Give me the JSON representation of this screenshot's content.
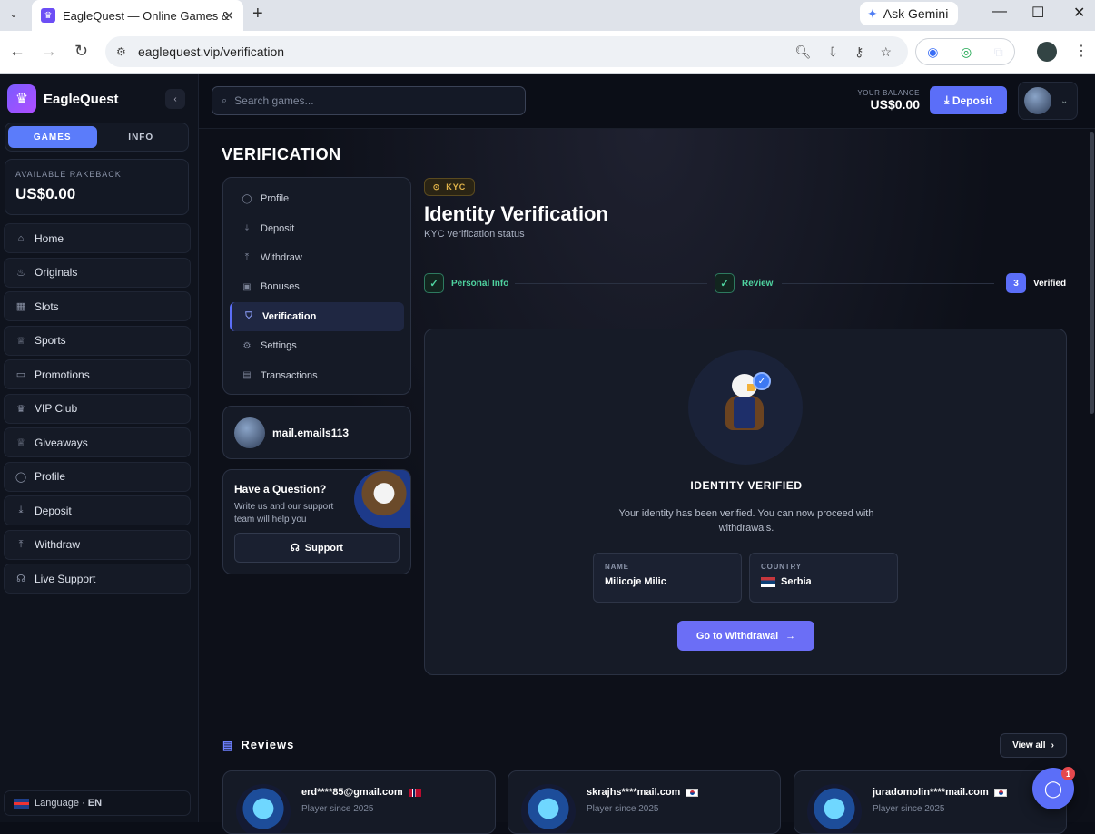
{
  "browser": {
    "tab_title": "EagleQuest — Online Games &",
    "gemini_label": "Ask Gemini",
    "url": "eaglequest.vip/verification",
    "icons": [
      "zoom-icon",
      "install-icon",
      "key-icon",
      "star-icon",
      "extension-icon",
      "profile-icon",
      "menu-icon"
    ]
  },
  "sidebar": {
    "brand": "EagleQuest",
    "tabs": [
      {
        "label": "GAMES",
        "active": true
      },
      {
        "label": "INFO",
        "active": false
      }
    ],
    "rakeback_label": "AVAILABLE RAKEBACK",
    "rakeback_value": "US$0.00",
    "items": [
      {
        "label": "Home",
        "icon": "home-icon"
      },
      {
        "label": "Originals",
        "icon": "flame-icon"
      },
      {
        "label": "Slots",
        "icon": "grid-icon"
      },
      {
        "label": "Sports",
        "icon": "trophy-icon"
      },
      {
        "label": "Promotions",
        "icon": "ticket-icon"
      },
      {
        "label": "VIP Club",
        "icon": "crown-icon"
      },
      {
        "label": "Giveaways",
        "icon": "trophy-icon"
      },
      {
        "label": "Profile",
        "icon": "user-icon"
      },
      {
        "label": "Deposit",
        "icon": "download-icon"
      },
      {
        "label": "Withdraw",
        "icon": "upload-icon"
      },
      {
        "label": "Live Support",
        "icon": "headset-icon"
      }
    ],
    "language_label": "Language ·",
    "language_code": "EN"
  },
  "topbar": {
    "search_placeholder": "Search games...",
    "balance_label": "YOUR BALANCE",
    "balance_value": "US$0.00",
    "deposit_label": "Deposit"
  },
  "page": {
    "title": "VERIFICATION",
    "menu": [
      {
        "label": "Profile",
        "icon": "user-icon",
        "active": false
      },
      {
        "label": "Deposit",
        "icon": "download-icon",
        "active": false
      },
      {
        "label": "Withdraw",
        "icon": "upload-icon",
        "active": false
      },
      {
        "label": "Bonuses",
        "icon": "gift-icon",
        "active": false
      },
      {
        "label": "Verification",
        "icon": "shield-icon",
        "active": true
      },
      {
        "label": "Settings",
        "icon": "gear-icon",
        "active": false
      },
      {
        "label": "Transactions",
        "icon": "receipt-icon",
        "active": false
      }
    ],
    "username": "mail.emails113",
    "help_title": "Have a Question?",
    "help_text": "Write us and our support team will help you",
    "support_label": "Support"
  },
  "kyc": {
    "badge": "KYC",
    "title": "Identity Verification",
    "subtitle": "KYC verification status",
    "steps": [
      {
        "label": "Personal Info",
        "state": "done"
      },
      {
        "label": "Review",
        "state": "done"
      },
      {
        "label": "Verified",
        "number": "3",
        "state": "current"
      }
    ],
    "status_title": "IDENTITY VERIFIED",
    "status_text": "Your identity has been verified. You can now proceed with withdrawals.",
    "name_label": "NAME",
    "name_value": "Milicoje Milic",
    "country_label": "COUNTRY",
    "country_value": "Serbia",
    "withdraw_button": "Go to Withdrawal"
  },
  "reviews": {
    "title": "Reviews",
    "view_all": "View all",
    "items": [
      {
        "name": "erd****85@gmail.com",
        "since": "Player since 2025",
        "flag": "norway"
      },
      {
        "name": "skrajhs****mail.com",
        "since": "Player since 2025",
        "flag": "south-korea"
      },
      {
        "name": "juradomolin****mail.com",
        "since": "Player since 2025",
        "flag": "south-korea"
      }
    ]
  },
  "chat": {
    "badge": "1"
  }
}
